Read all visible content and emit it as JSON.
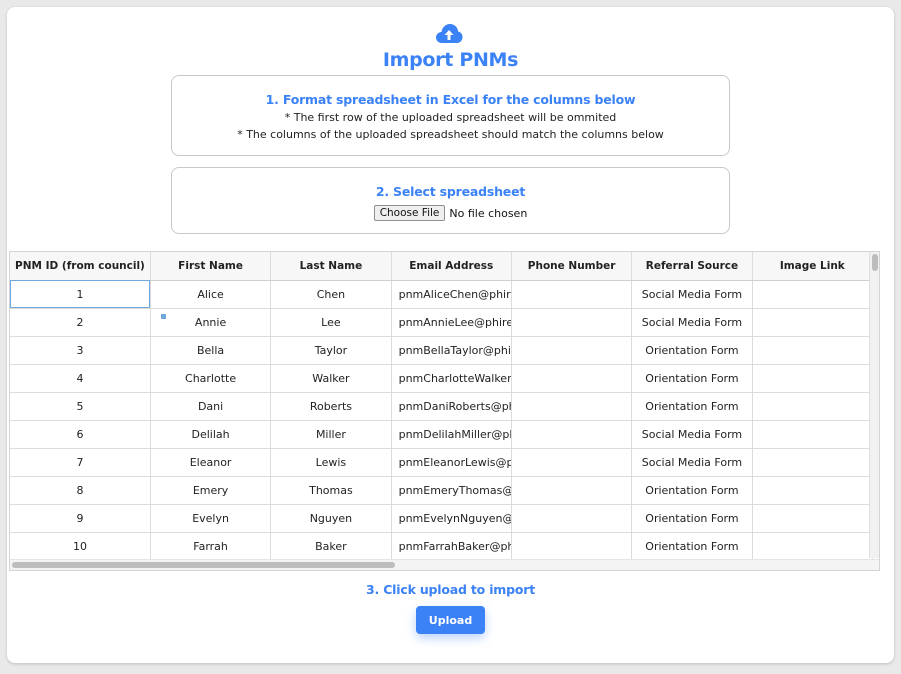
{
  "page": {
    "title": "Import PNMs",
    "accent_color": "#3b82f6",
    "icon": "cloud-upload-icon"
  },
  "step1": {
    "heading": "1. Format spreadsheet in Excel for the columns below",
    "notes": [
      "* The first row of the uploaded spreadsheet will be ommited",
      "* The columns of the uploaded spreadsheet should match the columns below"
    ]
  },
  "step2": {
    "heading": "2. Select spreadsheet",
    "file_button": "Choose File",
    "file_status": "No file chosen"
  },
  "grid": {
    "columns": [
      "PNM ID (from council)",
      "First Name",
      "Last Name",
      "Email Address",
      "Phone Number",
      "Referral Source",
      "Image Link"
    ],
    "rows": [
      [
        "1",
        "Alice",
        "Chen",
        "pnmAliceChen@phire",
        "",
        "Social Media Form",
        ""
      ],
      [
        "2",
        "Annie",
        "Lee",
        "pnmAnnieLee@phirec",
        "",
        "Social Media Form",
        ""
      ],
      [
        "3",
        "Bella",
        "Taylor",
        "pnmBellaTaylor@phir",
        "",
        "Orientation Form",
        ""
      ],
      [
        "4",
        "Charlotte",
        "Walker",
        "pnmCharlotteWalker",
        "",
        "Orientation Form",
        ""
      ],
      [
        "5",
        "Dani",
        "Roberts",
        "pnmDaniRoberts@ph",
        "",
        "Orientation Form",
        ""
      ],
      [
        "6",
        "Delilah",
        "Miller",
        "pnmDelilahMiller@ph",
        "",
        "Social Media Form",
        ""
      ],
      [
        "7",
        "Eleanor",
        "Lewis",
        "pnmEleanorLewis@pl",
        "",
        "Social Media Form",
        ""
      ],
      [
        "8",
        "Emery",
        "Thomas",
        "pnmEmeryThomas@",
        "",
        "Orientation Form",
        ""
      ],
      [
        "9",
        "Evelyn",
        "Nguyen",
        "pnmEvelynNguyen@p",
        "",
        "Orientation Form",
        ""
      ],
      [
        "10",
        "Farrah",
        "Baker",
        "pnmFarrahBaker@ph",
        "",
        "Orientation Form",
        ""
      ]
    ]
  },
  "step3": {
    "heading": "3. Click upload to import",
    "button": "Upload"
  }
}
